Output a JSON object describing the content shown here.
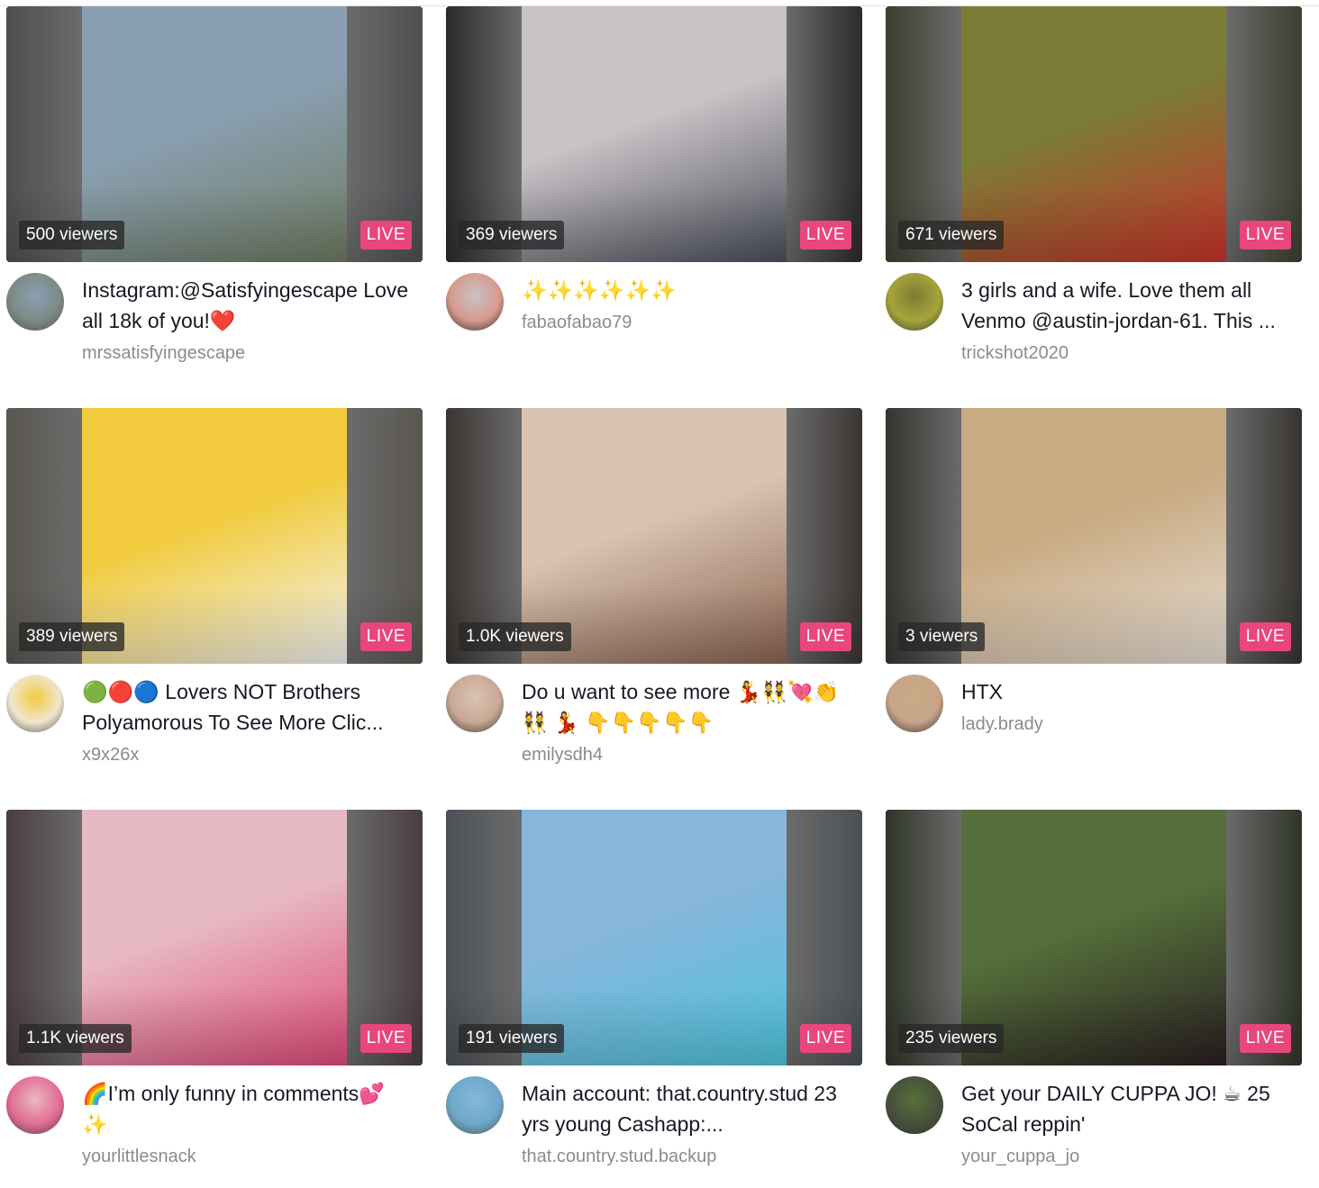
{
  "badges": {
    "live": "LIVE"
  },
  "streams": [
    {
      "viewers": "500 viewers",
      "title": "Instagram:@Satisfyingescape Love all 18k of you!❤️",
      "user": "mrssatisfyingescape",
      "side": "#4d4f52",
      "c1": "#8aa0b2",
      "c2": "#6f7b62",
      "av": "#7d8a86"
    },
    {
      "viewers": "369 viewers",
      "title": "✨✨✨✨✨✨",
      "user": "fabaofabao79",
      "side": "#2c2a2c",
      "c1": "#c9c2c6",
      "c2": "#4a4f5a",
      "av": "#d79a8c"
    },
    {
      "viewers": "671 viewers",
      "title": "3 girls and a wife. Love them all Venmo @austin-jordan-61. This ...",
      "user": "trickshot2020",
      "side": "#3c4030",
      "c1": "#7b7c35",
      "c2": "#c8322a",
      "av": "#a7a43a"
    },
    {
      "viewers": "389 viewers",
      "title": "🟢🔴🔵 Lovers NOT Brothers Polyamorous To See More Clic...",
      "user": "x9x26x",
      "side": "#5a5650",
      "c1": "#f1cb3d",
      "c2": "#f4f4f2",
      "av": "#efe6cf"
    },
    {
      "viewers": "1.0K viewers",
      "title": "Do u want to see more 💃👯💘👏👯 💃 👇👇👇👇👇",
      "user": "emilysdh4",
      "side": "#3b3532",
      "c1": "#d9c4b2",
      "c2": "#8b6350",
      "av": "#c9a894"
    },
    {
      "viewers": "3 viewers",
      "title": "HTX",
      "user": "lady.brady",
      "side": "#37342f",
      "c1": "#c9ab84",
      "c2": "#e7ddd3",
      "av": "#c7a48a"
    },
    {
      "viewers": "1.1K viewers",
      "title": "🌈I’m only funny in comments💕 ✨",
      "user": "yourlittlesnack",
      "side": "#4a3d41",
      "c1": "#e7b9c3",
      "c2": "#e04b7a",
      "av": "#e36d93"
    },
    {
      "viewers": "191 viewers",
      "title": "Main account: that.country.stud 23 yrs young Cashapp:...",
      "user": "that.country.stud.backup",
      "side": "#4b5157",
      "c1": "#86b6dc",
      "c2": "#4fc4dd",
      "av": "#6ea8c9"
    },
    {
      "viewers": "235 viewers",
      "title": "Get your DAILY CUPPA JO! ☕ 25 SoCal reppin'",
      "user": "your_cuppa_jo",
      "side": "#2f3528",
      "c1": "#55703a",
      "c2": "#2a1f22",
      "av": "#48503c"
    }
  ]
}
